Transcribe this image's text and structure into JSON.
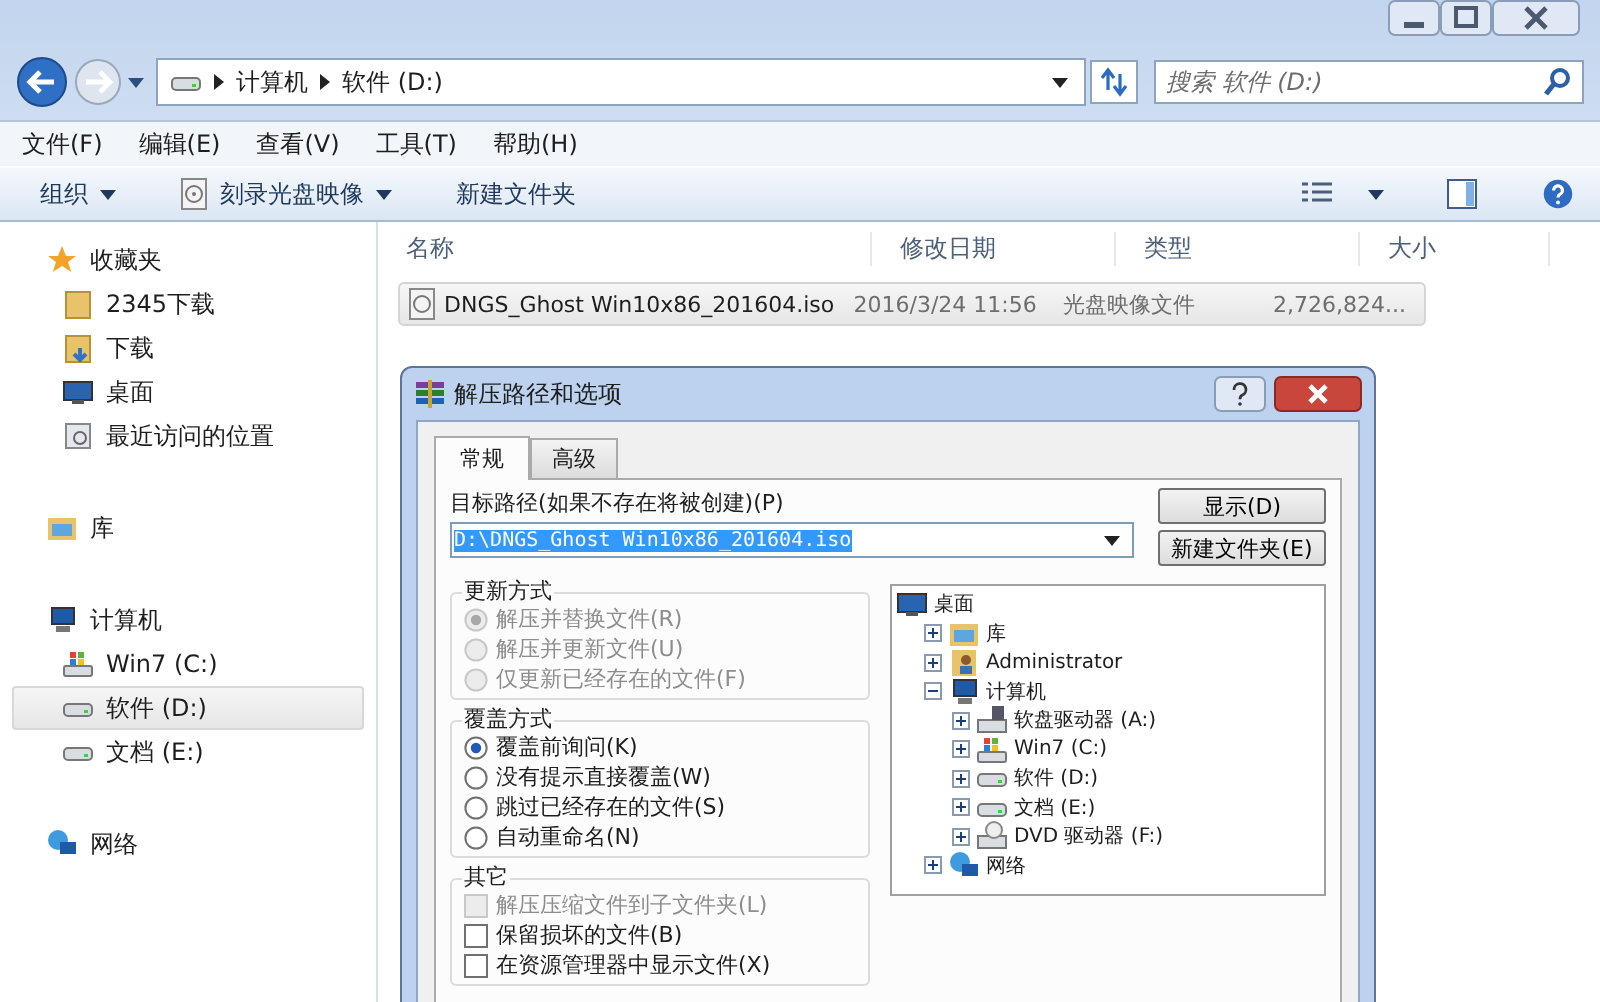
{
  "nav": {
    "breadcrumbs": [
      "计算机",
      "软件 (D:)"
    ],
    "search": {
      "placeholder": "搜索 软件 (D:)"
    }
  },
  "menu": [
    "文件(F)",
    "编辑(E)",
    "查看(V)",
    "工具(T)",
    "帮助(H)"
  ],
  "toolbar": [
    {
      "label": "组织",
      "dropdown": true,
      "kind": "plain"
    },
    {
      "label": "刻录光盘映像",
      "dropdown": true,
      "kind": "disc"
    },
    {
      "label": "新建文件夹",
      "dropdown": false,
      "kind": "plain"
    }
  ],
  "sidebar": {
    "sections": [
      {
        "label": "收藏夹",
        "kind": "star",
        "selected": false,
        "items": [
          {
            "label": "2345下载",
            "kind": "folder",
            "selected": false
          },
          {
            "label": "下载",
            "kind": "download",
            "selected": false
          },
          {
            "label": "桌面",
            "kind": "desktop",
            "selected": false
          },
          {
            "label": "最近访问的位置",
            "kind": "recent",
            "selected": false
          }
        ]
      },
      {
        "label": "库",
        "kind": "library",
        "selected": false
      },
      {
        "label": "计算机",
        "kind": "computer",
        "selected": false,
        "items": [
          {
            "label": "Win7 (C:)",
            "kind": "windrive",
            "selected": false
          },
          {
            "label": "软件 (D:)",
            "kind": "drive",
            "selected": true
          },
          {
            "label": "文档 (E:)",
            "kind": "drive",
            "selected": false
          }
        ]
      },
      {
        "label": "网络",
        "kind": "network",
        "selected": false
      }
    ]
  },
  "table": {
    "columns": [
      "名称",
      "修改日期",
      "类型",
      "大小"
    ],
    "rows": [
      {
        "name": "DNGS_Ghost Win10x86_201604.iso",
        "date": "2016/3/24 11:56",
        "type": "光盘映像文件",
        "size": "2,726,824...",
        "selected": true
      }
    ]
  },
  "dialog": {
    "title": "解压路径和选项",
    "tabs": [
      {
        "label": "常规",
        "selected": true
      },
      {
        "label": "高级",
        "selected": false
      }
    ],
    "path": {
      "label": "目标路径(如果不存在将被创建)(P)",
      "value": "D:\\DNGS_Ghost Win10x86_201604.iso",
      "selected": true
    },
    "buttons": [
      "显示(D)",
      "新建文件夹(E)"
    ],
    "groups": [
      {
        "title": "更新方式",
        "options": [
          {
            "label": "解压并替换文件(R)",
            "kind": "radio",
            "checked": true,
            "disabled": true
          },
          {
            "label": "解压并更新文件(U)",
            "kind": "radio",
            "checked": false,
            "disabled": true
          },
          {
            "label": "仅更新已经存在的文件(F)",
            "kind": "radio",
            "checked": false,
            "disabled": true
          }
        ]
      },
      {
        "title": "覆盖方式",
        "options": [
          {
            "label": "覆盖前询问(K)",
            "kind": "radio",
            "checked": true,
            "disabled": false
          },
          {
            "label": "没有提示直接覆盖(W)",
            "kind": "radio",
            "checked": false,
            "disabled": false
          },
          {
            "label": "跳过已经存在的文件(S)",
            "kind": "radio",
            "checked": false,
            "disabled": false
          },
          {
            "label": "自动重命名(N)",
            "kind": "radio",
            "checked": false,
            "disabled": false
          }
        ]
      },
      {
        "title": "其它",
        "options": [
          {
            "label": "解压压缩文件到子文件夹(L)",
            "kind": "checkbox",
            "checked": false,
            "disabled": true
          },
          {
            "label": "保留损坏的文件(B)",
            "kind": "checkbox",
            "checked": false,
            "disabled": false
          },
          {
            "label": "在资源管理器中显示文件(X)",
            "kind": "checkbox",
            "checked": false,
            "disabled": false
          }
        ]
      }
    ],
    "tree": [
      {
        "label": "桌面",
        "kind": "desktop",
        "children": [
          {
            "label": "库",
            "kind": "library",
            "expanded": false
          },
          {
            "label": "Administrator",
            "kind": "user",
            "expanded": false
          },
          {
            "label": "计算机",
            "kind": "computer",
            "expanded": true,
            "children": [
              {
                "label": "软盘驱动器 (A:)",
                "kind": "floppy",
                "expanded": false
              },
              {
                "label": "Win7 (C:)",
                "kind": "windrive",
                "expanded": false
              },
              {
                "label": "软件 (D:)",
                "kind": "drive",
                "expanded": false
              },
              {
                "label": "文档 (E:)",
                "kind": "drive",
                "expanded": false
              },
              {
                "label": "DVD 驱动器 (F:)",
                "kind": "dvd",
                "expanded": false
              }
            ]
          },
          {
            "label": "网络",
            "kind": "network",
            "expanded": false
          }
        ]
      }
    ]
  }
}
